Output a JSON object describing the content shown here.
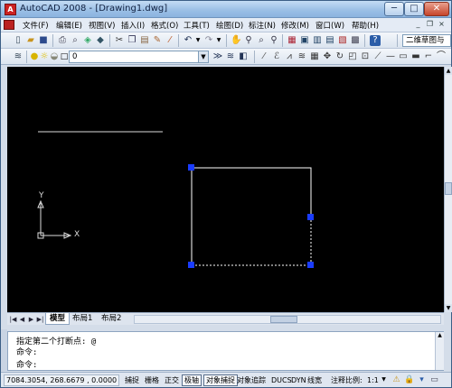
{
  "window": {
    "title": "AutoCAD 2008 - [Drawing1.dwg]",
    "controls": {
      "minimize": "─",
      "maximize": "□",
      "close": "✕"
    }
  },
  "menu": {
    "items": [
      "文件(F)",
      "编辑(E)",
      "视图(V)",
      "插入(I)",
      "格式(O)",
      "工具(T)",
      "绘图(D)",
      "标注(N)",
      "修改(M)",
      "窗口(W)",
      "帮助(H)"
    ],
    "doc_controls": {
      "minimize": "_",
      "restore": "❐",
      "close": "×"
    }
  },
  "toolbar_standard": {
    "icons": [
      "new-icon",
      "open-icon",
      "save-icon",
      "plot-icon",
      "preview-icon",
      "publish-icon",
      "cut-icon",
      "copy-icon",
      "paste-icon",
      "match-properties-icon",
      "undo-icon",
      "redo-icon",
      "pan-icon",
      "zoom-realtime-icon",
      "zoom-window-icon",
      "zoom-previous-icon",
      "properties-icon",
      "design-center-icon",
      "tool-palettes-icon",
      "sheet-set-icon",
      "markup-icon",
      "quick-calc-icon",
      "help-icon"
    ],
    "workspace": "二维草图与"
  },
  "toolbar_layers": {
    "layer_name": "0",
    "icons": [
      "layer-manager-icon",
      "lightbulb-icon",
      "sun-icon",
      "lock-icon",
      "color-square-icon",
      "layer-previous-icon",
      "make-current-icon",
      "layer-states-icon"
    ],
    "modify_icons": [
      "erase-icon",
      "copy-object-icon",
      "mirror-icon",
      "offset-icon",
      "array-icon",
      "move-icon",
      "rotate-icon",
      "scale-icon",
      "stretch-icon",
      "trim-icon",
      "extend-icon",
      "break-icon",
      "join-icon"
    ]
  },
  "ucs": {
    "x_label": "X",
    "y_label": "Y"
  },
  "tabs": {
    "items": [
      "模型",
      "布局1",
      "布局2"
    ],
    "active": "模型"
  },
  "command": {
    "lines": [
      "指定第二个打断点: @",
      "命令:",
      "命令:"
    ]
  },
  "status": {
    "coordinates": "7084.3054, 268.6679 , 0.0000",
    "toggles": [
      {
        "label": "捕捉",
        "on": false
      },
      {
        "label": "栅格",
        "on": false
      },
      {
        "label": "正交",
        "on": false
      },
      {
        "label": "极轴",
        "on": true
      },
      {
        "label": "对象捕捉",
        "on": true
      },
      {
        "label": "对象追踪",
        "on": false
      },
      {
        "label": "DUCS",
        "on": false
      },
      {
        "label": "DYN",
        "on": false
      },
      {
        "label": "线宽",
        "on": false
      }
    ],
    "annotation_scale_label": "注释比例:",
    "annotation_scale_value": "1:1"
  },
  "colors": {
    "canvas": "#000000",
    "grip": "#1a3cff",
    "line": "#ffffff",
    "titlebar": "#9cc0e6"
  }
}
